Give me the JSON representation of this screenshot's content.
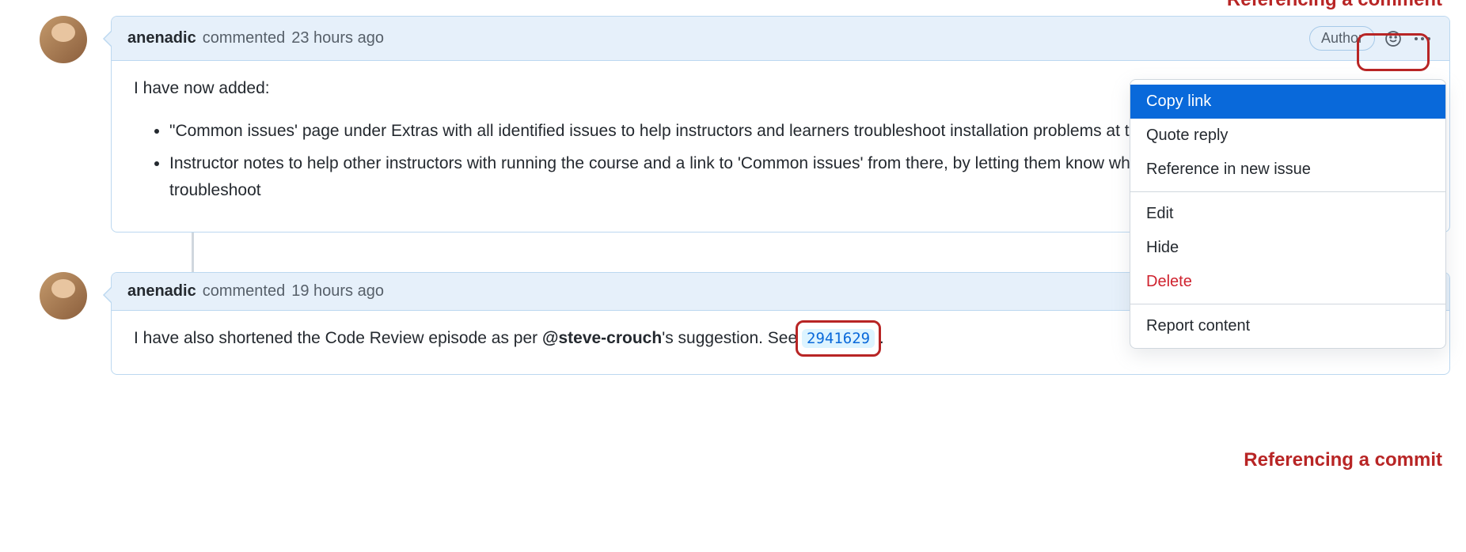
{
  "annotations": {
    "top": "Referencing a comment",
    "bottom": "Referencing a commit"
  },
  "comments": [
    {
      "author": "anenadic",
      "action": "commented",
      "timestamp": "23 hours ago",
      "badge": "Author",
      "body_intro": "I have now added:",
      "body_list": [
        "\"Common issues' page under Extras with all identified issues to help instructors and learners troubleshoot installation problems at the workshop",
        "Instructor notes to help other instructors with running the course and a link to 'Common issues' from there, by letting them know what might go wrong and how to troubleshoot"
      ]
    },
    {
      "author": "anenadic",
      "action": "commented",
      "timestamp": "19 hours ago",
      "body_prefix": "I have also shortened the Code Review episode as per ",
      "mention": "@steve-crouch",
      "body_mid": "'s suggestion. See ",
      "commit": "2941629",
      "body_suffix": "."
    }
  ],
  "menu": {
    "items": [
      "Copy link",
      "Quote reply",
      "Reference in new issue"
    ],
    "items2": [
      "Edit",
      "Hide"
    ],
    "delete": "Delete",
    "report": "Report content"
  }
}
